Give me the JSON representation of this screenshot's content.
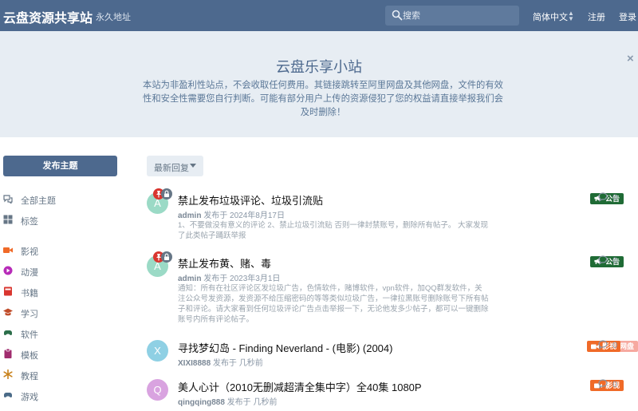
{
  "header": {
    "brand": "云盘资源共享站",
    "permalink": "永久地址",
    "search_placeholder": "搜索",
    "language": "简体中文",
    "register": "注册",
    "login": "登录"
  },
  "hero": {
    "title": "云盘乐享小站",
    "text": "本站为非盈利性站点，不会收取任何费用。其链接跳转至阿里网盘及其他网盘，文件的有效性和安全性需要您自行判断。可能有部分用户上传的资源侵犯了您的权益请直接举报我们会及时删除！",
    "close": "×"
  },
  "sidebar": {
    "post_button": "发布主题",
    "items": [
      {
        "label": "全部主题",
        "icon": "chat-bubbles-icon",
        "color": "#667686"
      },
      {
        "label": "标签",
        "icon": "grid-icon",
        "color": "#667686"
      },
      {
        "label": "影视",
        "icon": "video-camera-icon",
        "color": "#f06a28"
      },
      {
        "label": "动漫",
        "icon": "play-circle-icon",
        "color": "#b72bb8"
      },
      {
        "label": "书籍",
        "icon": "book-icon",
        "color": "#d9362f"
      },
      {
        "label": "学习",
        "icon": "graduation-cap-icon",
        "color": "#c04d2a"
      },
      {
        "label": "软件",
        "icon": "gamepad-icon",
        "color": "#2c6e4a"
      },
      {
        "label": "模板",
        "icon": "clipboard-icon",
        "color": "#a02c6e"
      },
      {
        "label": "教程",
        "icon": "snowflake-icon",
        "color": "#c8821c"
      },
      {
        "label": "游戏",
        "icon": "gamepad-icon",
        "color": "#4b6b88"
      }
    ]
  },
  "sort": {
    "label": "最新回复"
  },
  "discussions": [
    {
      "avatar_letter": "A",
      "avatar_color": "#9bdac6",
      "title": "禁止发布垃圾评论、垃圾引流贴",
      "user": "admin",
      "posted": "发布于 2024年8月17日",
      "excerpt": "1、不要做没有意义的评论 2、禁止垃圾引流贴 否则一律封禁账号，删除所有帖子。 大家发现了此类帖子踊跃举报",
      "tags": [
        {
          "label": "公告",
          "icon": "megaphone-icon",
          "color": "#1f6b35"
        }
      ],
      "replies": "0",
      "pinned": true,
      "locked": true
    },
    {
      "avatar_letter": "A",
      "avatar_color": "#9bdac6",
      "title": "禁止发布黄、赌、毒",
      "user": "admin",
      "posted": "发布于 2023年3月1日",
      "excerpt": "通知：所有在社区评论区发垃圾广告，色情软件，赌博软件，vpn软件，加QQ群发软件，关注公众号发资源，发资源不给压缩密码的等等类似垃圾广告，一律拉黑账号删除账号下所有帖子和评论。请大家看到任何垃圾评论广告点击举报一下，无论他发多少帖子，都可以一键删除账号内所有评论帖子。",
      "tags": [
        {
          "label": "公告",
          "icon": "megaphone-icon",
          "color": "#1f6b35"
        }
      ],
      "replies": "0",
      "pinned": true,
      "locked": true
    },
    {
      "avatar_letter": "X",
      "avatar_color": "#8fd0e4",
      "title": "寻找梦幻岛 - Finding Neverland - (电影) (2004)",
      "user": "XIXI8888",
      "posted": "发布于 几秒前",
      "excerpt": "",
      "tags": [
        {
          "label": "影视",
          "icon": "video-camera-icon",
          "color": "#f06a28"
        },
        {
          "label": "夸克网盘",
          "icon": "cloud-icon",
          "color": "#f6a9a0"
        }
      ],
      "replies": "0",
      "pinned": false,
      "locked": false
    },
    {
      "avatar_letter": "Q",
      "avatar_color": "#d9a3e0",
      "title": "美人心计（2010无删减超清全集中字）全40集 1080P",
      "user": "qingqing888",
      "posted": "发布于 几秒前",
      "excerpt": "",
      "tags": [
        {
          "label": "影视",
          "icon": "video-camera-icon",
          "color": "#f06a28"
        }
      ],
      "replies": "0",
      "pinned": false,
      "locked": false
    }
  ],
  "colors": {
    "header_bg": "#4d698e",
    "hero_bg": "#e7edf3",
    "pinned_badge": "#d9362f",
    "locked_badge": "#667686"
  }
}
